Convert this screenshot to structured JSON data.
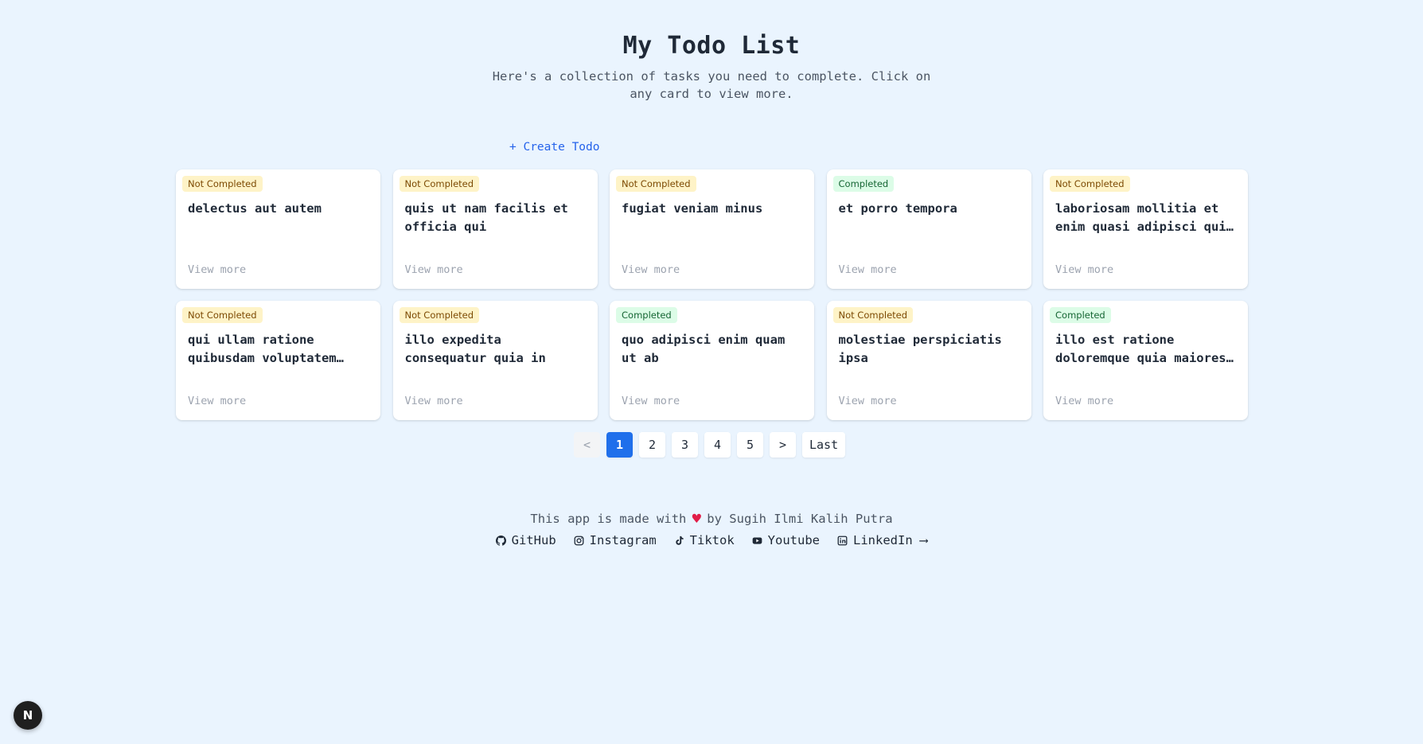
{
  "header": {
    "title": "My Todo List",
    "subtitle": "Here's a collection of tasks you need to complete. Click on any card to view more."
  },
  "create_label": "+ Create Todo",
  "todos": [
    {
      "status": "Not Completed",
      "done": false,
      "title": "delectus aut autem",
      "link": "View more"
    },
    {
      "status": "Not Completed",
      "done": false,
      "title": "quis ut nam facilis et officia qui",
      "link": "View more"
    },
    {
      "status": "Not Completed",
      "done": false,
      "title": "fugiat veniam minus",
      "link": "View more"
    },
    {
      "status": "Completed",
      "done": true,
      "title": "et porro tempora",
      "link": "View more"
    },
    {
      "status": "Not Completed",
      "done": false,
      "title": "laboriosam mollitia et enim quasi adipisci quia provident illum",
      "link": "View more"
    },
    {
      "status": "Not Completed",
      "done": false,
      "title": "qui ullam ratione quibusdam voluptatem quia omnis",
      "link": "View more"
    },
    {
      "status": "Not Completed",
      "done": false,
      "title": "illo expedita consequatur quia in",
      "link": "View more"
    },
    {
      "status": "Completed",
      "done": true,
      "title": "quo adipisci enim quam ut ab",
      "link": "View more"
    },
    {
      "status": "Not Completed",
      "done": false,
      "title": "molestiae perspiciatis ipsa",
      "link": "View more"
    },
    {
      "status": "Completed",
      "done": true,
      "title": "illo est ratione doloremque quia maiores aut",
      "link": "View more"
    }
  ],
  "pagination": {
    "prev": "<",
    "pages": [
      "1",
      "2",
      "3",
      "4",
      "5"
    ],
    "current": "1",
    "next": ">",
    "last": "Last"
  },
  "footer": {
    "made_with_before": "This app is made with",
    "heart": "♥",
    "made_with_after": "by Sugih Ilmi Kalih Putra",
    "links": [
      {
        "label": "GitHub",
        "icon": "github-icon"
      },
      {
        "label": "Instagram",
        "icon": "instagram-icon"
      },
      {
        "label": "Tiktok",
        "icon": "tiktok-icon"
      },
      {
        "label": "Youtube",
        "icon": "youtube-icon"
      },
      {
        "label": "LinkedIn ⟶",
        "icon": "linkedin-icon"
      }
    ]
  },
  "next_badge": "N",
  "colors": {
    "background": "#eaf4fe",
    "accent": "#1f6feb",
    "link": "#2563eb",
    "not_completed_bg": "#fef3c7",
    "completed_bg": "#dcfce7"
  }
}
